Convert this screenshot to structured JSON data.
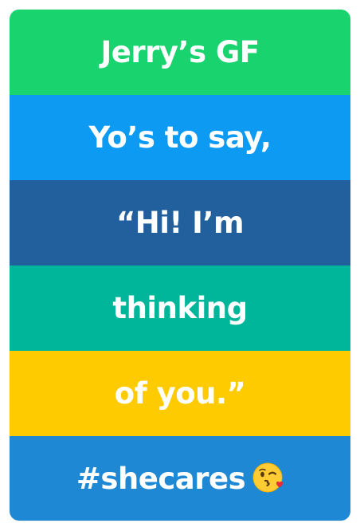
{
  "rows": [
    {
      "text": "Jerry’s GF",
      "color": "#19D36E"
    },
    {
      "text": "Yo’s to say,",
      "color": "#0D9AF3"
    },
    {
      "text": "“Hi! I’m",
      "color": "#225F9D"
    },
    {
      "text": "thinking",
      "color": "#00B69A"
    },
    {
      "text": "of you.”",
      "color": "#FDCB00"
    },
    {
      "text": "#shecares",
      "color": "#1F88D4",
      "icon": "kissing-face-winking-icon"
    }
  ]
}
